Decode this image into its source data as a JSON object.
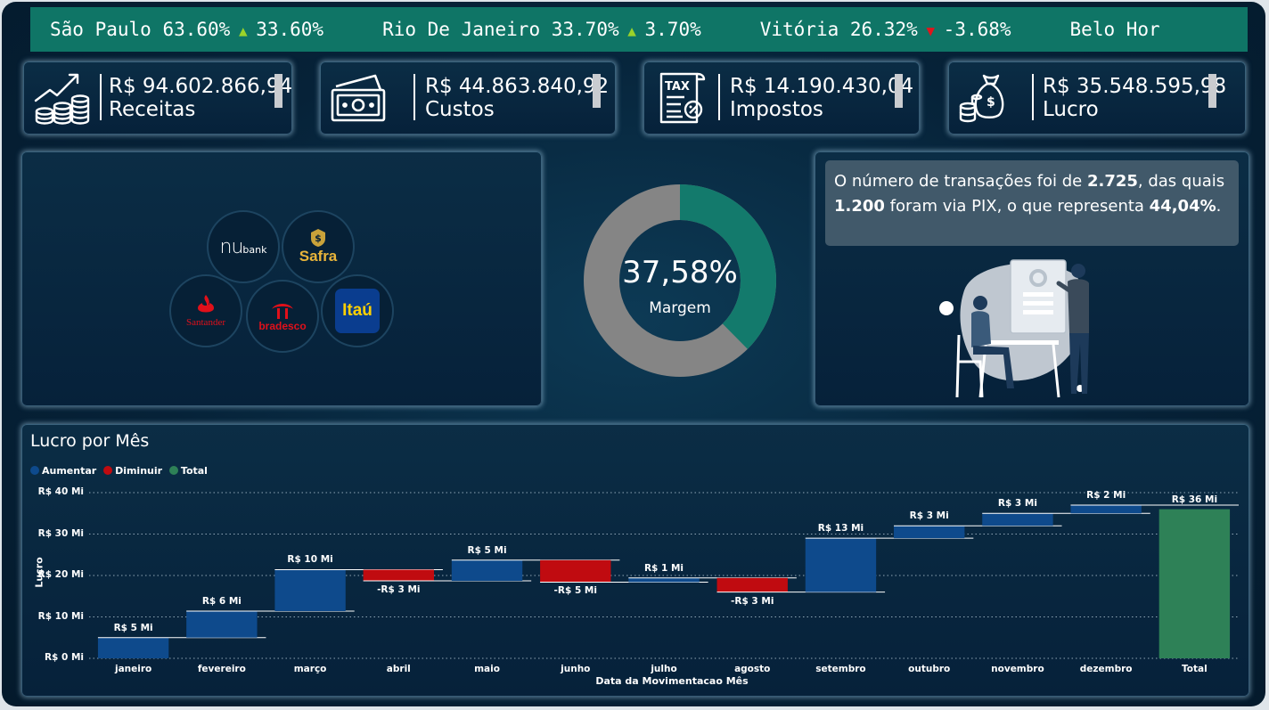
{
  "ticker": [
    {
      "city": "São Paulo",
      "pct": "63.60%",
      "dir": "up",
      "delta": "33.60%"
    },
    {
      "city": "Rio De Janeiro",
      "pct": "33.70%",
      "dir": "up",
      "delta": "3.70%"
    },
    {
      "city": "Vitória",
      "pct": "26.32%",
      "dir": "down",
      "delta": "-3.68%"
    },
    {
      "city": "Belo Hor",
      "pct": "",
      "dir": "",
      "delta": ""
    }
  ],
  "kpis": [
    {
      "value": "R$ 94.602.866,94",
      "label": "Receitas",
      "icon": "revenue-chart-icon"
    },
    {
      "value": "R$ 44.863.840,92",
      "label": "Custos",
      "icon": "money-bill-icon"
    },
    {
      "value": "R$ 14.190.430,04",
      "label": "Impostos",
      "icon": "tax-document-icon"
    },
    {
      "value": "R$ 35.548.595,98",
      "label": "Lucro",
      "icon": "money-bag-icon"
    }
  ],
  "banks": {
    "nubank": {
      "mark": "nu",
      "text": "bank"
    },
    "safra": "Safra",
    "santander": "Santander",
    "bradesco": "bradesco",
    "itau": "Itaú"
  },
  "donut": {
    "value_text": "37,58%",
    "label": "Margem",
    "fraction": 0.3758,
    "colors": {
      "value": "#137a6c",
      "rest": "#858585"
    }
  },
  "info": {
    "t1": "O número de transações foi de ",
    "b1": "2.725",
    "t2": ", das quais ",
    "b2": "1.200",
    "t3": " foram via PIX, o que representa ",
    "b3": "44,04%",
    "t4": "."
  },
  "chart_data": {
    "type": "waterfall",
    "title": "Lucro por Mês",
    "xlabel": "Data da Movimentacao Mês",
    "ylabel": "Lucro",
    "legend": [
      {
        "name": "Aumentar",
        "color": "#0e4a8c"
      },
      {
        "name": "Diminuir",
        "color": "#c00b10"
      },
      {
        "name": "Total",
        "color": "#2e8157"
      }
    ],
    "legend_position": "top-left",
    "yticks": [
      "R$ 0 Mi",
      "R$ 10 Mi",
      "R$ 20 Mi",
      "R$ 30 Mi",
      "R$ 40 Mi"
    ],
    "ylim": [
      0,
      40
    ],
    "grid": true,
    "categories": [
      "janeiro",
      "fevereiro",
      "março",
      "abril",
      "maio",
      "junho",
      "julho",
      "agosto",
      "setembro",
      "outubro",
      "novembro",
      "dezembro",
      "Total"
    ],
    "deltas": [
      5,
      6.4,
      10,
      -2.7,
      5,
      -5.3,
      1,
      -3.4,
      13,
      3,
      3,
      2,
      0
    ],
    "labels": [
      "R$ 5 Mi",
      "R$ 6 Mi",
      "R$ 10 Mi",
      "-R$ 3 Mi",
      "R$ 5 Mi",
      "-R$ 5 Mi",
      "R$ 1 Mi",
      "-R$ 3 Mi",
      "R$ 13 Mi",
      "R$ 3 Mi",
      "R$ 3 Mi",
      "R$ 2 Mi",
      "R$ 36 Mi"
    ],
    "total": 36
  }
}
